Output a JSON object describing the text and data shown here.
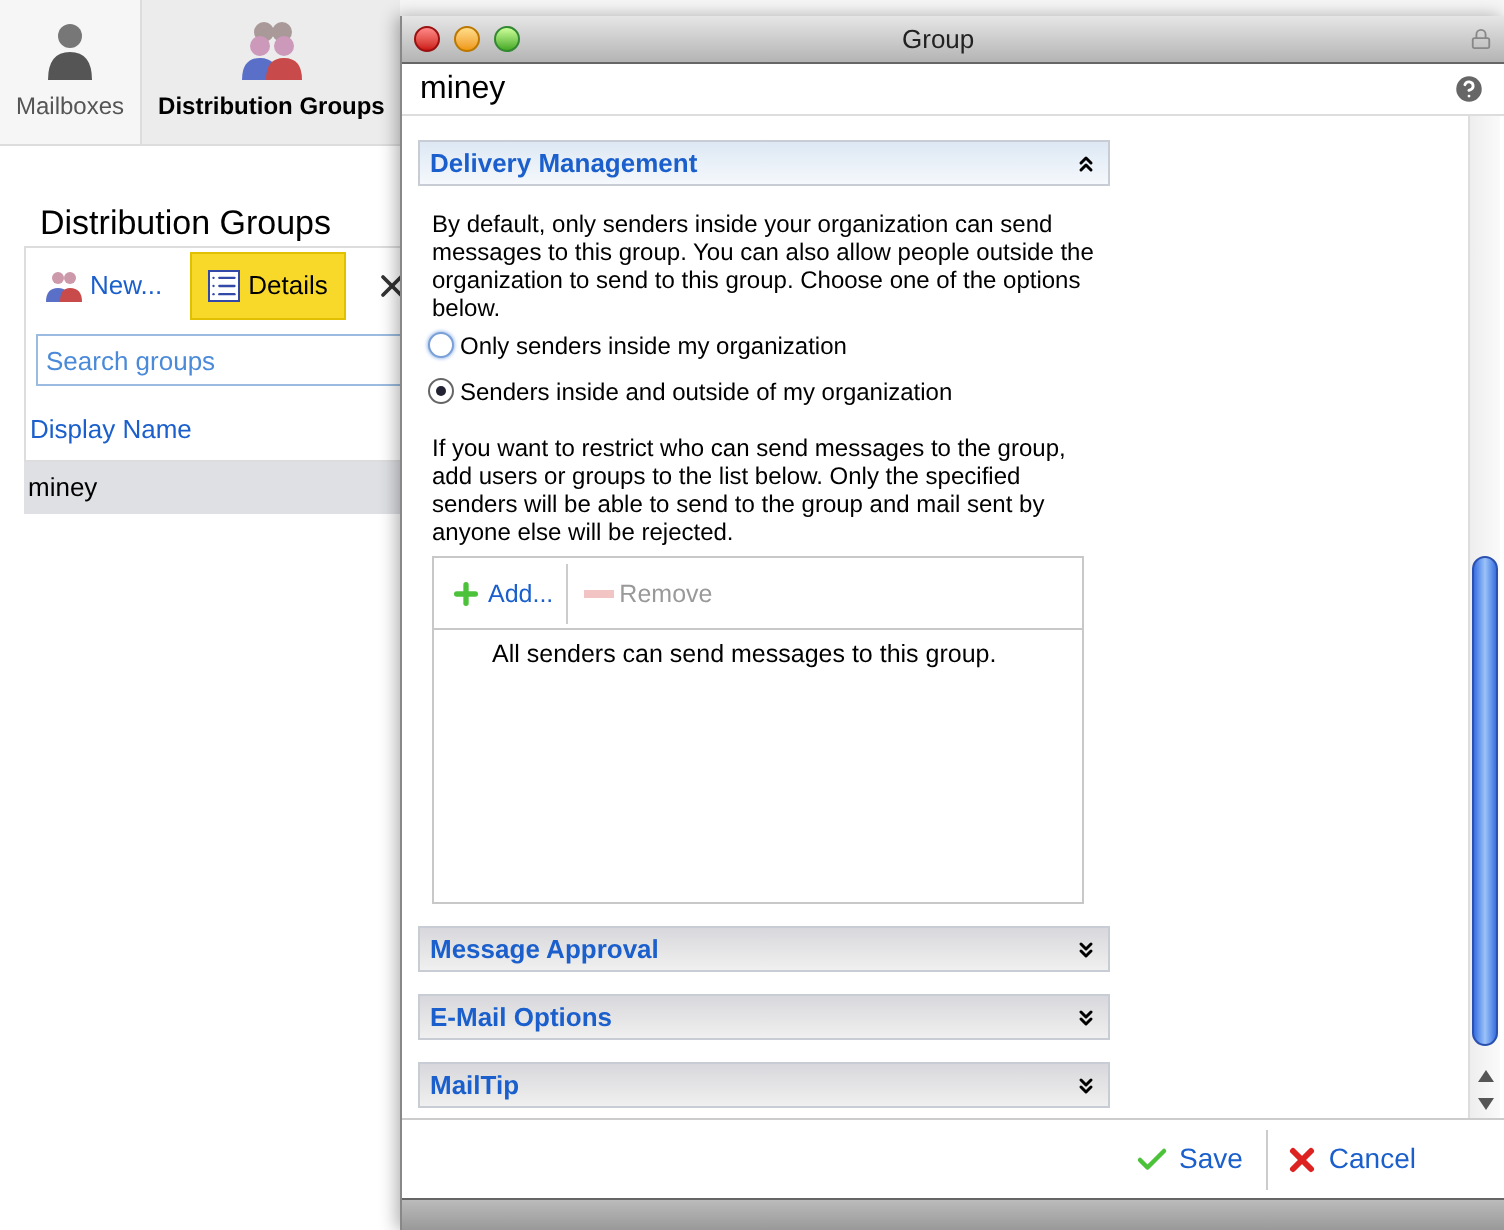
{
  "nav_tabs": [
    {
      "label": "Mailboxes",
      "selected": false
    },
    {
      "label": "Distribution Groups",
      "selected": true
    }
  ],
  "page_title": "Distribution Groups",
  "toolbar": [
    {
      "label": "New...",
      "kind": "new",
      "selected": false
    },
    {
      "label": "Details",
      "kind": "details",
      "selected": true
    },
    {
      "kind": "delete",
      "selected": false
    }
  ],
  "search": {
    "placeholder": "Search groups"
  },
  "table": {
    "columns": [
      "Display Name"
    ],
    "rows": [
      {
        "cells": [
          "miney"
        ],
        "selected": true
      }
    ]
  },
  "dialog": {
    "title": "Group",
    "name": "miney",
    "sections": [
      {
        "title": "Delivery Management",
        "expanded": true,
        "intro": "By default, only senders inside your organization can send messages to this group. You can also allow people outside the organization to send to this group. Choose one of the options below.",
        "options": [
          {
            "label": "Only senders inside my organization",
            "selected": false
          },
          {
            "label": "Senders inside and outside of my organization",
            "selected": true
          }
        ],
        "restrict_text": "If you want to restrict who can send messages to the group, add users or groups to the list below. Only the specified senders will be able to send to the group and mail sent by anyone else will be rejected.",
        "list_buttons": [
          {
            "label": "Add...",
            "kind": "add",
            "disabled": false
          },
          {
            "label": "Remove",
            "kind": "remove",
            "disabled": true
          }
        ],
        "list_empty": "All senders can send messages to this group."
      },
      {
        "title": "Message Approval",
        "expanded": false
      },
      {
        "title": "E-Mail Options",
        "expanded": false
      },
      {
        "title": "MailTip",
        "expanded": false
      }
    ],
    "buttons": [
      {
        "label": "Save",
        "kind": "save"
      },
      {
        "label": "Cancel",
        "kind": "cancel"
      }
    ]
  }
}
